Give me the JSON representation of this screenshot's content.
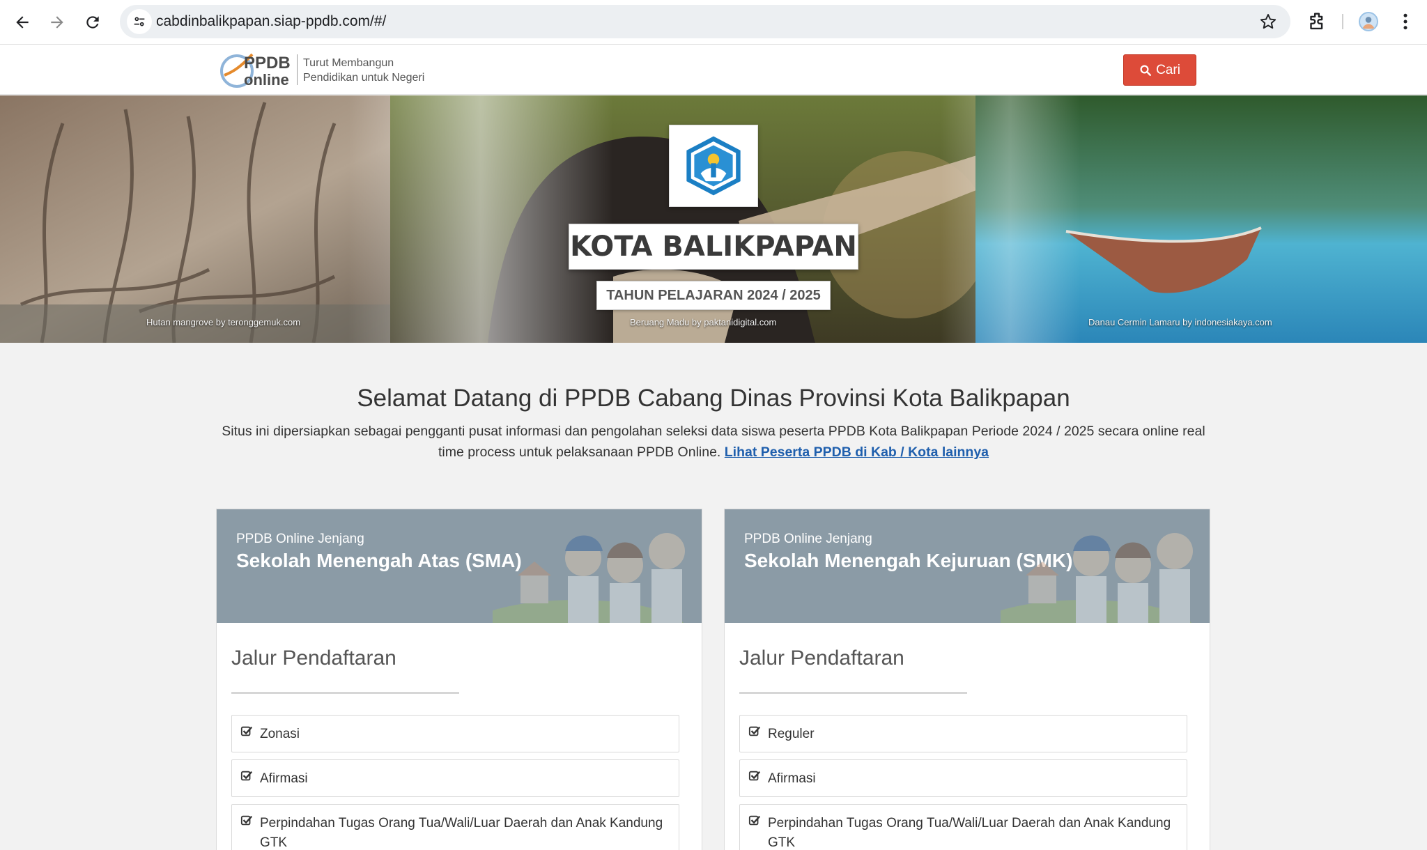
{
  "browser": {
    "url": "cabdinbalikpapan.siap-ppdb.com/#/"
  },
  "header": {
    "logo_text_top": "PPDB",
    "logo_text_bottom": "online",
    "tagline_line1": "Turut Membangun",
    "tagline_line2": "Pendidikan untuk Negeri",
    "search_label": "Cari"
  },
  "hero": {
    "title": "KOTA BALIKPAPAN",
    "subtitle": "TAHUN PELAJARAN 2024 / 2025",
    "credits": [
      "Hutan mangrove by teronggemuk.com",
      "Beruang Madu by paktanidigital.com",
      "Danau Cermin Lamaru by indonesiakaya.com"
    ]
  },
  "welcome": {
    "title": "Selamat Datang di PPDB Cabang Dinas Provinsi Kota Balikpapan",
    "description": "Situs ini dipersiapkan sebagai pengganti pusat informasi dan pengolahan seleksi data siswa peserta PPDB Kota Balikpapan Periode 2024 / 2025 secara online real time process untuk pelaksanaan PPDB Online.",
    "link_label": "Lihat Peserta PPDB di Kab / Kota lainnya"
  },
  "cards": [
    {
      "kicker": "PPDB Online Jenjang",
      "name": "Sekolah Menengah Atas (SMA)",
      "section_title": "Jalur Pendaftaran",
      "items": [
        "Zonasi",
        "Afirmasi",
        "Perpindahan Tugas Orang Tua/Wali/Luar Daerah dan Anak Kandung GTK"
      ]
    },
    {
      "kicker": "PPDB Online Jenjang",
      "name": "Sekolah Menengah Kejuruan (SMK)",
      "section_title": "Jalur Pendaftaran",
      "items": [
        "Reguler",
        "Afirmasi",
        "Perpindahan Tugas Orang Tua/Wali/Luar Daerah dan Anak Kandung GTK"
      ]
    }
  ],
  "colors": {
    "search_button": "#dd4b39",
    "card_header": "#8b9ba6",
    "link": "#1f5fad"
  }
}
